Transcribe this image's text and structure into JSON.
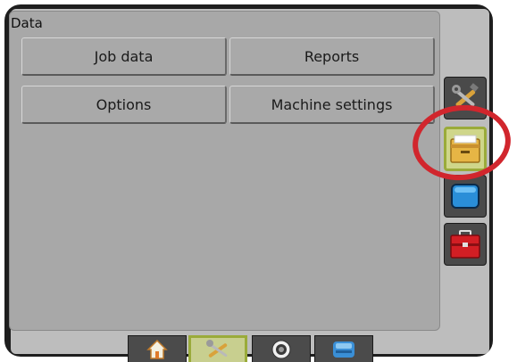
{
  "panel": {
    "title": "Data"
  },
  "menu": {
    "job_data": "Job data",
    "reports": "Reports",
    "options": "Options",
    "machine_settings": "Machine settings"
  },
  "side_tabs": [
    {
      "icon": "tools-icon",
      "active": false
    },
    {
      "icon": "file-box-icon",
      "active": true
    },
    {
      "icon": "display-icon",
      "active": false
    },
    {
      "icon": "toolbox-icon",
      "active": false
    }
  ],
  "bottom_tabs": [
    {
      "icon": "home-icon",
      "active": false
    },
    {
      "icon": "tools-icon",
      "active": true
    },
    {
      "icon": "camera-icon",
      "active": false
    },
    {
      "icon": "console-icon",
      "active": false
    }
  ],
  "colors": {
    "active_tab": "#cfd68a",
    "active_border": "#9aab3a",
    "highlight": "#d1262d",
    "toolbox": "#d21e24",
    "display": "#2a8ed8"
  }
}
